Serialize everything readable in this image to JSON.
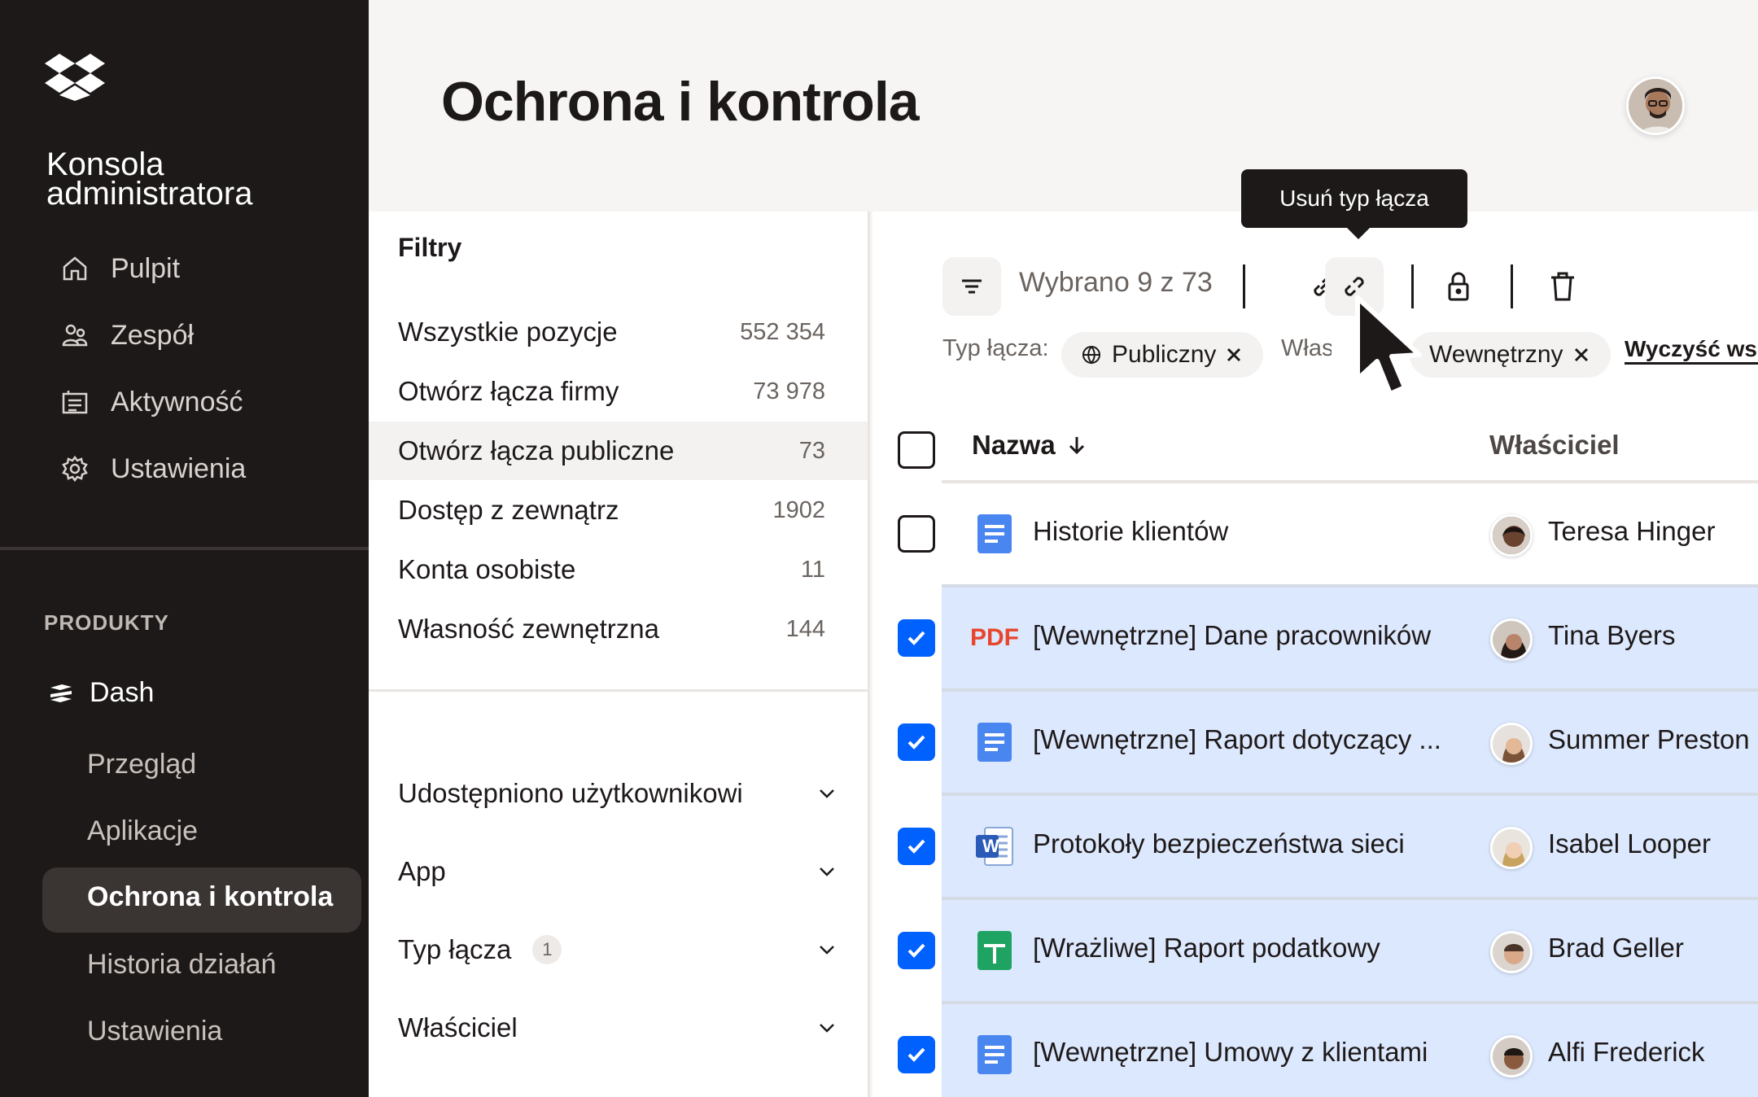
{
  "app": {
    "console_title_line1": "Konsola",
    "console_title_line2": "administratora"
  },
  "sidebar": {
    "nav": [
      {
        "label": "Pulpit",
        "icon": "home-icon"
      },
      {
        "label": "Zespół",
        "icon": "team-icon"
      },
      {
        "label": "Aktywność",
        "icon": "activity-icon"
      },
      {
        "label": "Ustawienia",
        "icon": "settings-gear-icon"
      }
    ],
    "products_label": "PRODUKTY",
    "dash_label": "Dash",
    "sub_items": [
      "Przegląd",
      "Aplikacje",
      "Ochrona i kontrola",
      "Historia działań",
      "Ustawienia"
    ],
    "active_sub": "Ochrona i kontrola"
  },
  "header": {
    "title": "Ochrona i kontrola"
  },
  "filters": {
    "title": "Filtry",
    "rows": [
      {
        "label": "Wszystkie pozycje",
        "count": "552 354"
      },
      {
        "label": "Otwórz łącza firmy",
        "count": "73 978"
      },
      {
        "label": "Otwórz łącza publiczne",
        "count": "73"
      },
      {
        "label": "Dostęp z zewnątrz",
        "count": "1902"
      },
      {
        "label": "Konta osobiste",
        "count": "11"
      },
      {
        "label": "Własność zewnętrzna",
        "count": "144"
      }
    ],
    "accordions": [
      {
        "label": "Udostępniono użytkownikowi",
        "badge": ""
      },
      {
        "label": "App",
        "badge": ""
      },
      {
        "label": "Typ łącza",
        "badge": "1"
      },
      {
        "label": "Właściciel",
        "badge": ""
      }
    ]
  },
  "toolbar": {
    "selection_text": "Wybrano 9 z 73",
    "tooltip": "Usuń typ łącza",
    "link_type_label": "Typ łącza:",
    "chip_public": "Publiczny",
    "ownership_label_partial": "Własno",
    "chip_internal": "Wewnętrzny",
    "clear_all": "Wyczyść wszystkie"
  },
  "table": {
    "col_name": "Nazwa",
    "col_owner": "Właściciel",
    "rows": [
      {
        "name": "Historie klientów",
        "owner": "Teresa Hinger",
        "checked": false,
        "type": "doc"
      },
      {
        "name": "[Wewnętrzne] Dane pracowników",
        "owner": "Tina Byers",
        "checked": true,
        "type": "pdf",
        "type_label": "PDF"
      },
      {
        "name": "[Wewnętrzne] Raport dotyczący ...",
        "owner": "Summer Preston",
        "checked": true,
        "type": "doc"
      },
      {
        "name": "Protokoły bezpieczeństwa sieci",
        "owner": "Isabel Looper",
        "checked": true,
        "type": "word",
        "type_label": "W"
      },
      {
        "name": "[Wrażliwe] Raport podatkowy",
        "owner": "Brad Geller",
        "checked": true,
        "type": "sheet"
      },
      {
        "name": "[Wewnętrzne] Umowy z klientami",
        "owner": "Alfi Frederick",
        "checked": true,
        "type": "doc"
      }
    ]
  },
  "colors": {
    "accent": "#0061fe",
    "sidebar_bg": "#1e1919",
    "selected_row": "#dce8fd",
    "pdf_red": "#e8452c"
  }
}
